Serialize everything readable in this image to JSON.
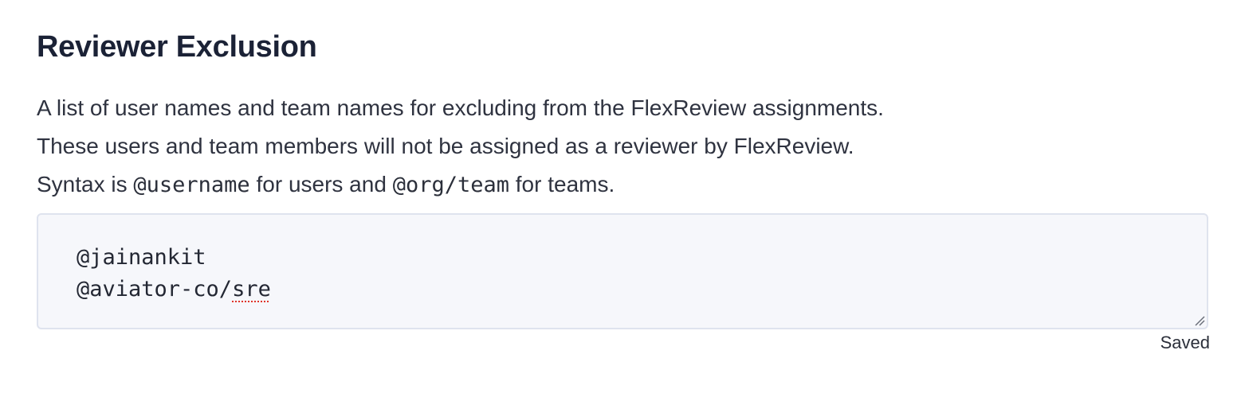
{
  "section": {
    "title": "Reviewer Exclusion",
    "description": {
      "line1": "A list of user names and team names for excluding from the FlexReview assignments.",
      "line2": "These users and team members will not be assigned as a reviewer by FlexReview.",
      "line3_prefix": "Syntax is ",
      "line3_user_syntax": "@username",
      "line3_middle": " for users and ",
      "line3_team_syntax": "@org/team",
      "line3_suffix": " for teams."
    },
    "exclusion_list": {
      "line1": "@jainankit",
      "line2_prefix": "@aviator-co/",
      "line2_misspelled": "sre"
    },
    "status": "Saved"
  },
  "colors": {
    "title": "#1b2236",
    "text": "#2f3340",
    "textarea_bg": "#f6f7fb",
    "textarea_border": "#dfe3ee",
    "spellcheck": "#e0342a"
  },
  "icons": {
    "resize_handle": "resize-handle-icon"
  }
}
